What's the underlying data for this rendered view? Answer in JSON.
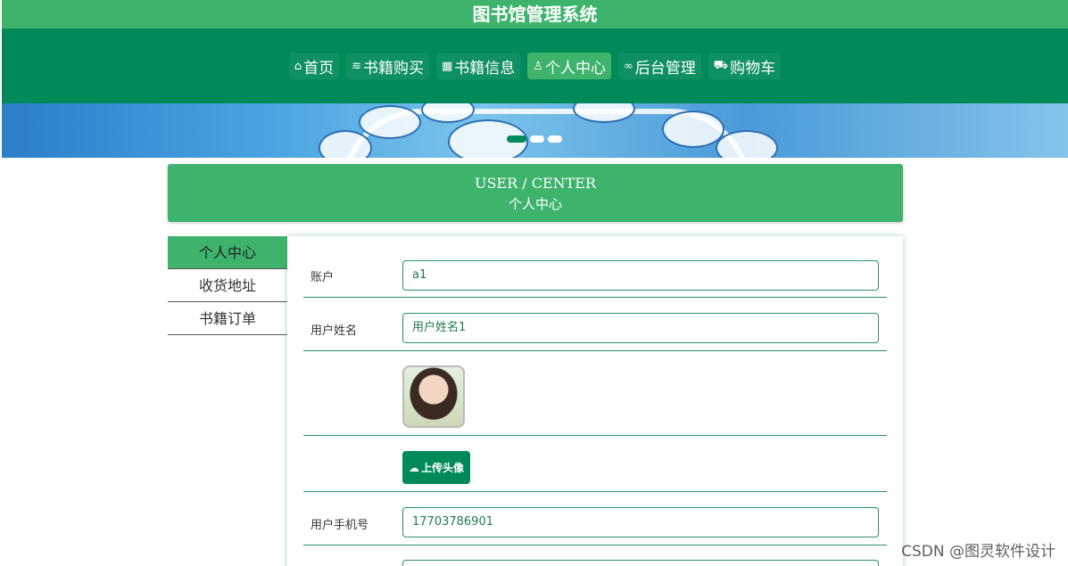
{
  "app": {
    "title": "图书馆管理系统"
  },
  "nav": {
    "items": [
      {
        "icon": "⌂",
        "label": "首页"
      },
      {
        "icon": "≋",
        "label": "书籍购买"
      },
      {
        "icon": "▦",
        "label": "书籍信息"
      },
      {
        "icon": "♙",
        "label": "个人中心"
      },
      {
        "icon": "∞",
        "label": "后台管理"
      },
      {
        "icon": "⛟",
        "label": "购物车"
      }
    ],
    "active": "个人中心"
  },
  "banner": {
    "slides": 3,
    "active_slide": 1
  },
  "section": {
    "title_en": "USER / CENTER",
    "title_cn": "个人中心"
  },
  "sidebar": {
    "items": [
      {
        "label": "个人中心"
      },
      {
        "label": "收货地址"
      },
      {
        "label": "书籍订单"
      }
    ],
    "active": "个人中心"
  },
  "form": {
    "account_label": "账户",
    "account_value": "a1",
    "name_label": "用户姓名",
    "name_value": "用户姓名1",
    "upload_label": "上传头像",
    "phone_label": "用户手机号",
    "phone_value": "17703786901"
  },
  "watermark": "CSDN @图灵软件设计",
  "colors": {
    "primary": "#3db36b",
    "dark": "#008a5a",
    "border": "#2a8f6a"
  }
}
